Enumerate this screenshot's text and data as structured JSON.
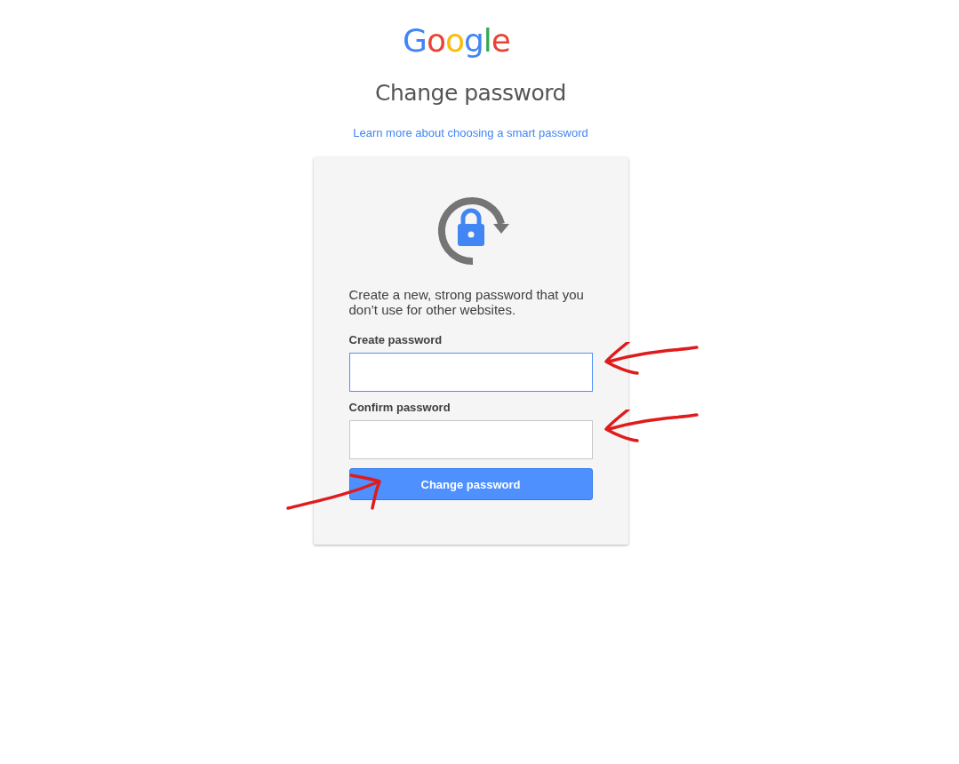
{
  "logo": {
    "text": "Google"
  },
  "title": "Change password",
  "help_link": "Learn more about choosing a smart password",
  "card": {
    "instructions": "Create a new, strong password that you don’t use for other websites.",
    "fields": [
      {
        "label": "Create password",
        "focused": true,
        "highlighted": true
      },
      {
        "label": "Confirm password",
        "focused": false,
        "highlighted": true
      }
    ],
    "button": {
      "label": "Change password",
      "highlighted": true
    }
  }
}
